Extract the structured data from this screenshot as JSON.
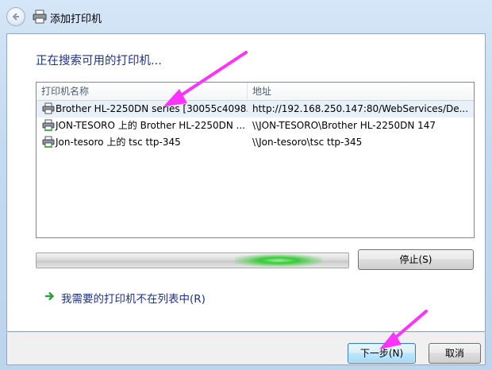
{
  "window": {
    "title": "添加打印机",
    "back_icon": "back-arrow-icon",
    "title_icon": "printer-icon"
  },
  "main": {
    "heading": "正在搜索可用的打印机...",
    "list": {
      "columns": [
        "打印机名称",
        "地址"
      ],
      "rows": [
        {
          "name": "Brother HL-2250DN series [30055c4098...",
          "address": "http://192.168.250.147:80/WebServices/De...",
          "icon": "network-printer-icon",
          "selected": true
        },
        {
          "name": "JON-TESORO 上的 Brother HL-2250DN ...",
          "address": "\\\\JON-TESORO\\Brother HL-2250DN 147",
          "icon": "shared-printer-icon",
          "selected": false
        },
        {
          "name": "Jon-tesoro 上的 tsc ttp-345",
          "address": "\\\\Jon-tesoro\\tsc ttp-345",
          "icon": "shared-printer-icon",
          "selected": false
        }
      ]
    },
    "stop_button": "停止(S)",
    "not_listed_link": "我需要的打印机不在列表中(R)"
  },
  "footer": {
    "next_button": "下一步(N)",
    "cancel_button": "取消"
  },
  "colors": {
    "heading": "#1e3287",
    "annotation": "#ff33ff",
    "progress_glow": "#38c938"
  }
}
